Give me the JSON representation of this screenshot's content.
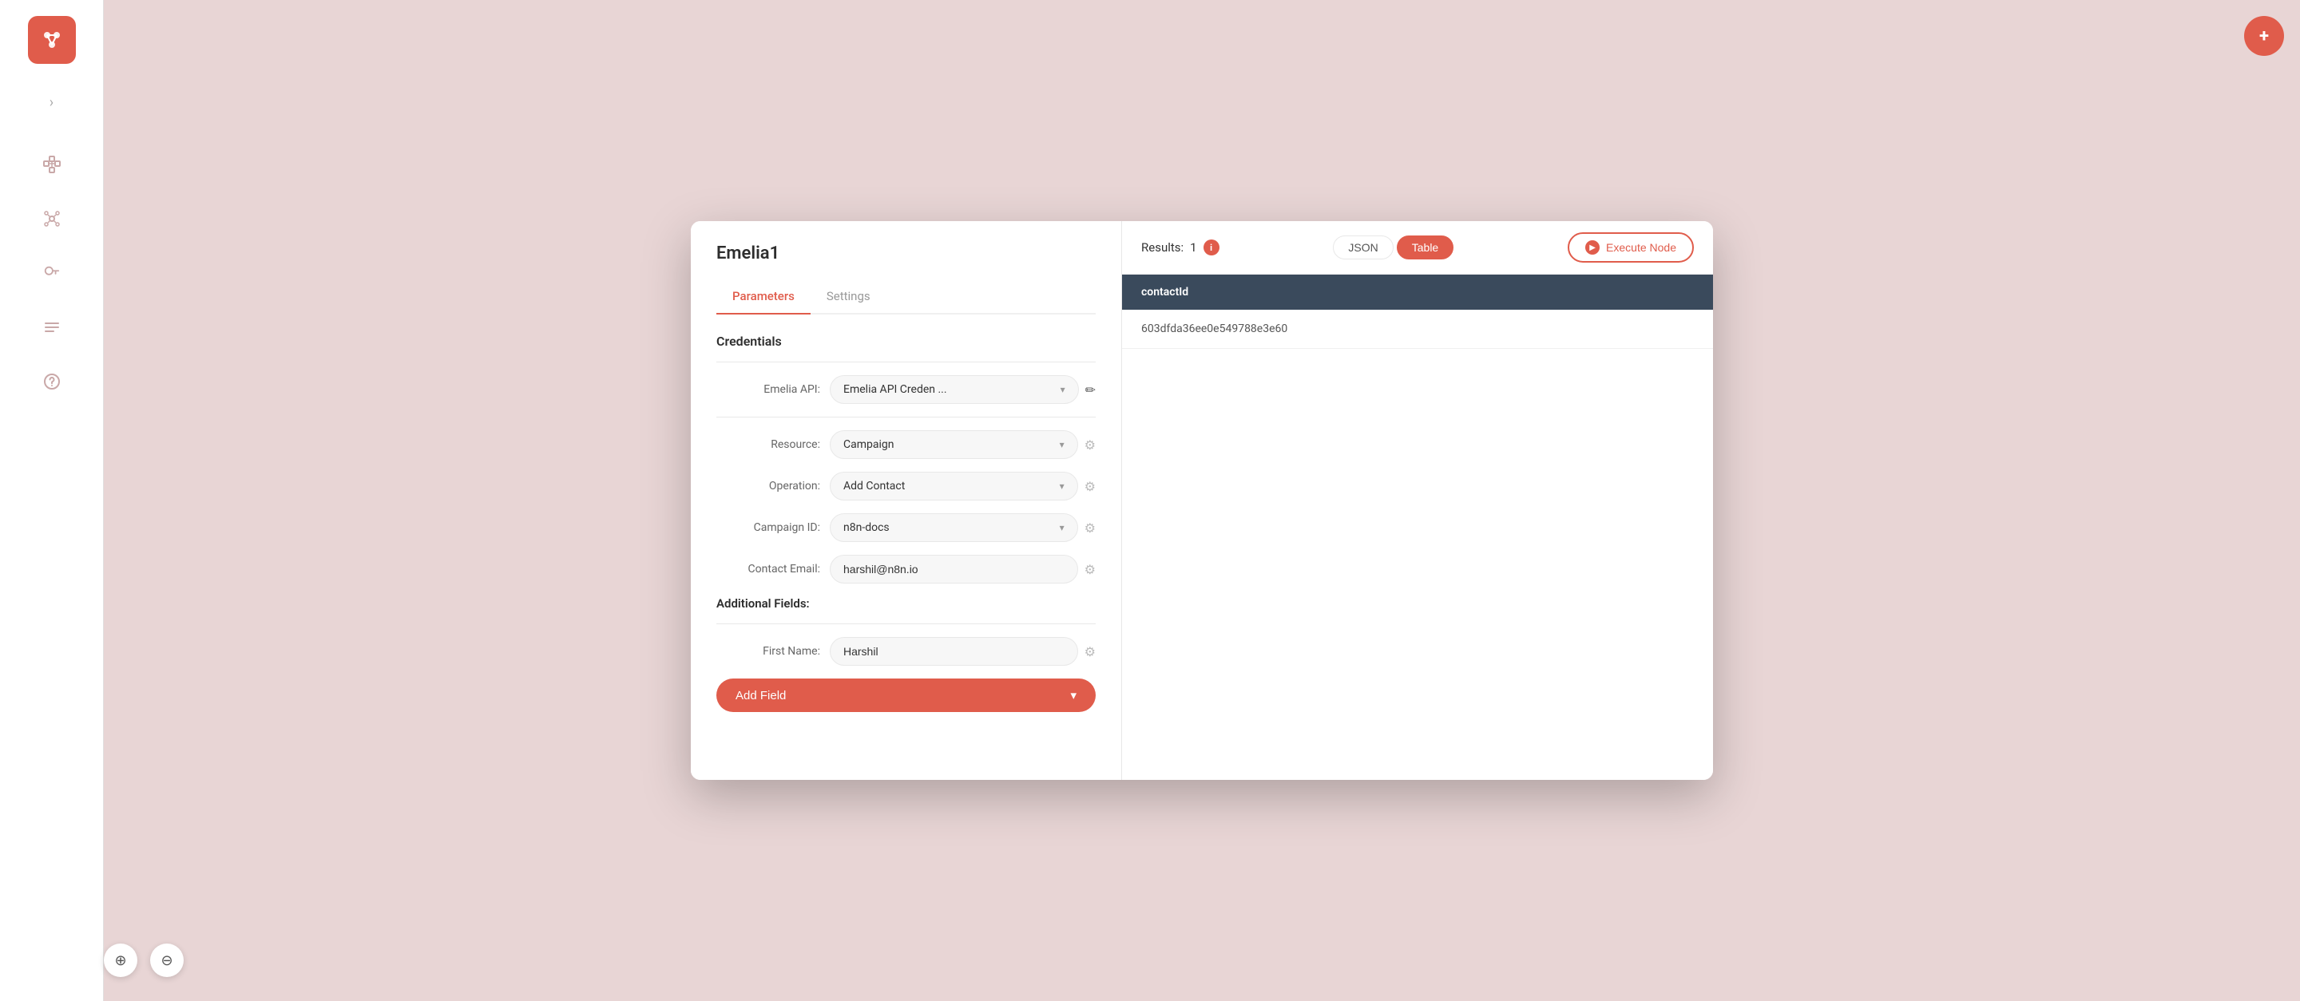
{
  "sidebar": {
    "logo_icon": "⟳",
    "toggle_icon": "›",
    "icons": [
      {
        "name": "nodes-icon",
        "symbol": "⊞"
      },
      {
        "name": "list-icon",
        "symbol": "☰"
      },
      {
        "name": "key-icon",
        "symbol": "🔑"
      },
      {
        "name": "menu-icon",
        "symbol": "≡"
      },
      {
        "name": "help-icon",
        "symbol": "?"
      }
    ]
  },
  "modal": {
    "title": "Emelia1",
    "tabs": [
      {
        "label": "Parameters",
        "active": true
      },
      {
        "label": "Settings",
        "active": false
      }
    ],
    "credentials_section": "Credentials",
    "fields": {
      "emelia_api_label": "Emelia API:",
      "emelia_api_value": "Emelia API Creden ...",
      "resource_label": "Resource:",
      "resource_value": "Campaign",
      "operation_label": "Operation:",
      "operation_value": "Add Contact",
      "campaign_id_label": "Campaign ID:",
      "campaign_id_value": "n8n-docs",
      "contact_email_label": "Contact Email:",
      "contact_email_value": "harshil@n8n.io"
    },
    "additional_fields_label": "Additional Fields:",
    "first_name_label": "First Name:",
    "first_name_value": "Harshil",
    "add_field_btn": "Add Field"
  },
  "results": {
    "label": "Results:",
    "count": "1",
    "view_json": "JSON",
    "view_table": "Table",
    "execute_node_label": "Execute Node",
    "table_header": "contactId",
    "table_value": "603dfda36ee0e549788e3e60"
  },
  "close_icon": "✕",
  "zoom": {
    "zoom_in": "⊕",
    "zoom_out": "⊖"
  },
  "avatar_initials": "+"
}
